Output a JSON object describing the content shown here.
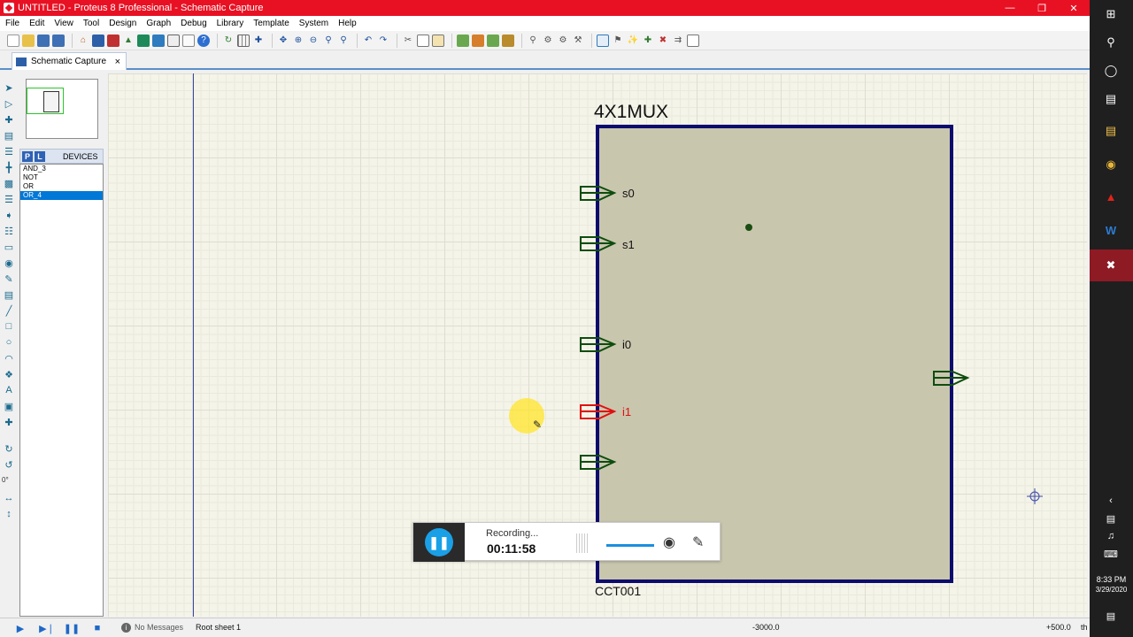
{
  "window": {
    "title": "UNTITLED - Proteus 8 Professional - Schematic Capture",
    "controls": [
      "minimize",
      "maximize",
      "close"
    ]
  },
  "menu": [
    "File",
    "Edit",
    "View",
    "Tool",
    "Design",
    "Graph",
    "Debug",
    "Library",
    "Template",
    "System",
    "Help"
  ],
  "tab": {
    "label": "Schematic Capture",
    "close": "×"
  },
  "devices": {
    "p_button": "P",
    "l_button": "L",
    "title": "DEVICES",
    "items": [
      "AND_3",
      "NOT",
      "OR",
      "OR_4"
    ],
    "selected_index": 3
  },
  "rotation_label": "0°",
  "schematic": {
    "component_name": "4X1MUX",
    "component_ref": "CCT001",
    "ports": [
      {
        "label": "s0",
        "color": "#0d4d0d"
      },
      {
        "label": "s1",
        "color": "#0d4d0d"
      },
      {
        "label": "i0",
        "color": "#0d4d0d"
      },
      {
        "label": "i1",
        "color": "#e01010"
      },
      {
        "label": "",
        "color": "#0d4d0d"
      },
      {
        "label": "",
        "color": "#0d4d0d"
      }
    ]
  },
  "recording": {
    "status": "Recording...",
    "time": "00:11:58"
  },
  "statusbar": {
    "messages": "No Messages",
    "sheet": "Root sheet 1",
    "x_coord": "-3000.0",
    "y_coord": "+500.0",
    "unit": "th"
  },
  "taskbar": {
    "time": "8:33 PM",
    "date": "3/29/2020"
  },
  "colors": {
    "titlebar": "#e81123",
    "component_border": "#0c0c6e",
    "component_fill": "#c9c6ae",
    "canvas": "#f5f4e9",
    "highlight": "#ffe628"
  }
}
